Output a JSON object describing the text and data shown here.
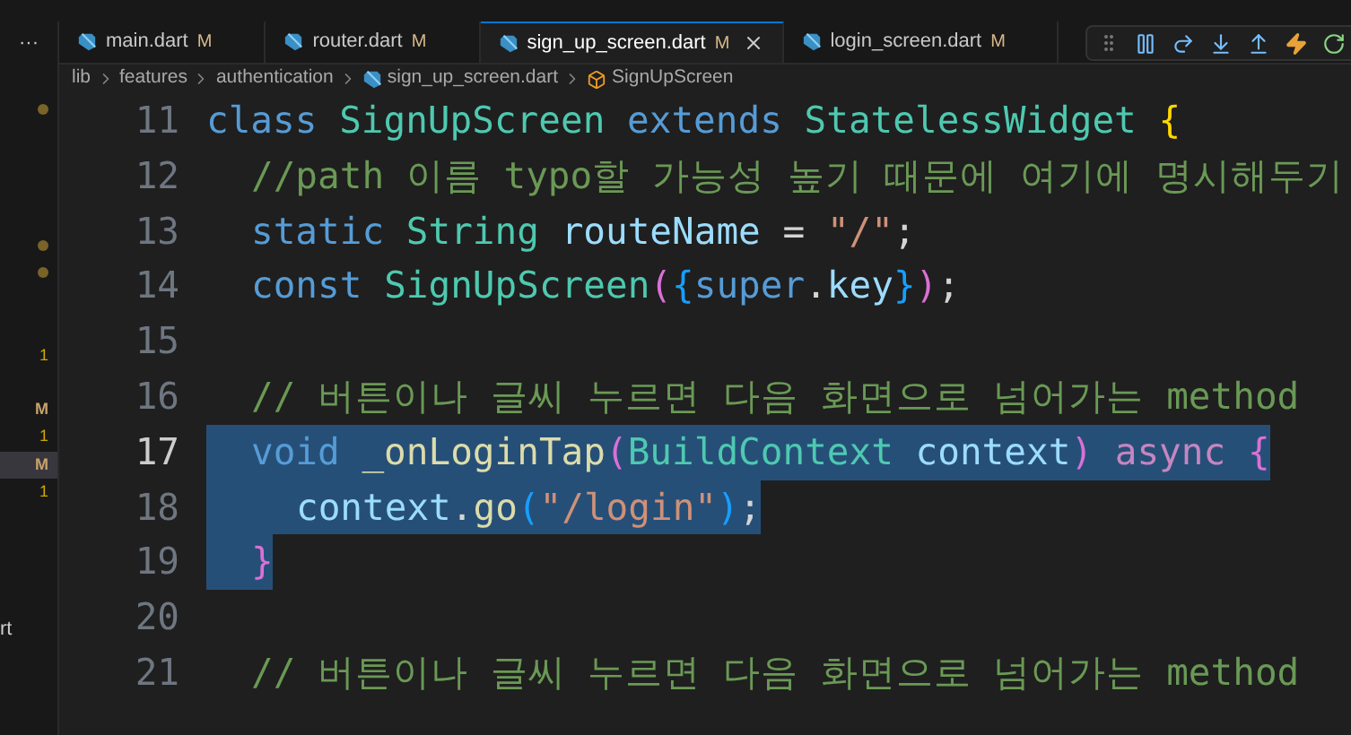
{
  "tabs": [
    {
      "label": "main.dart",
      "badge": "M",
      "selected": false
    },
    {
      "label": "router.dart",
      "badge": "M",
      "selected": false
    },
    {
      "label": "sign_up_screen.dart",
      "badge": "M",
      "selected": true
    },
    {
      "label": "login_screen.dart",
      "badge": "M",
      "selected": false
    }
  ],
  "overflow_menu": "···",
  "breadcrumb": [
    {
      "label": "lib",
      "kind": "folder"
    },
    {
      "label": "features",
      "kind": "folder"
    },
    {
      "label": "authentication",
      "kind": "folder"
    },
    {
      "label": "sign_up_screen.dart",
      "kind": "file"
    },
    {
      "label": "SignUpScreen",
      "kind": "class"
    }
  ],
  "explorer_rows": [
    {
      "kind": "dot"
    },
    {
      "kind": "empty"
    },
    {
      "kind": "empty"
    },
    {
      "kind": "empty"
    },
    {
      "kind": "empty"
    },
    {
      "kind": "dot"
    },
    {
      "kind": "dot"
    },
    {
      "kind": "empty"
    },
    {
      "kind": "empty"
    },
    {
      "kind": "count",
      "badge": "1",
      "selected": false
    },
    {
      "kind": "empty"
    },
    {
      "kind": "letter",
      "badge": "M",
      "selected": false
    },
    {
      "kind": "count",
      "badge": "1",
      "selected": false
    },
    {
      "kind": "letter",
      "badge": "M",
      "selected": true
    },
    {
      "kind": "count",
      "badge": "1",
      "selected": false
    },
    {
      "kind": "empty"
    },
    {
      "kind": "empty"
    },
    {
      "kind": "empty"
    },
    {
      "kind": "empty"
    },
    {
      "kind": "name",
      "name": "rt"
    }
  ],
  "code_lines": [
    {
      "number": "11",
      "kind": "top",
      "active": false,
      "selected": false,
      "tokens": [
        {
          "kind": "kw",
          "text": "class "
        },
        {
          "kind": "type",
          "text": "SignUpScreen "
        },
        {
          "kind": "kw",
          "text": "extends "
        },
        {
          "kind": "type",
          "text": "StatelessWidget "
        },
        {
          "kind": "brace",
          "text": "{"
        }
      ]
    },
    {
      "number": "12",
      "kind": "member",
      "active": false,
      "selected": false,
      "tokens": [
        {
          "kind": "comment",
          "text": "//path 이름 typo할 가능성 높기 때문에 여기에 명시해두기"
        }
      ]
    },
    {
      "number": "13",
      "kind": "member",
      "active": false,
      "selected": false,
      "tokens": [
        {
          "kind": "kw",
          "text": "static "
        },
        {
          "kind": "type",
          "text": "String "
        },
        {
          "kind": "var",
          "text": "routeName"
        },
        {
          "kind": "p",
          "text": " = "
        },
        {
          "kind": "str",
          "text": "\"/\""
        },
        {
          "kind": "p",
          "text": ";"
        }
      ]
    },
    {
      "number": "14",
      "kind": "member",
      "active": false,
      "selected": false,
      "tokens": [
        {
          "kind": "kw",
          "text": "const "
        },
        {
          "kind": "type",
          "text": "SignUpScreen"
        },
        {
          "kind": "bracket",
          "text": "("
        },
        {
          "kind": "bracket2",
          "text": "{"
        },
        {
          "kind": "kw",
          "text": "super"
        },
        {
          "kind": "p",
          "text": "."
        },
        {
          "kind": "var",
          "text": "key"
        },
        {
          "kind": "bracket2",
          "text": "}"
        },
        {
          "kind": "bracket",
          "text": ")"
        },
        {
          "kind": "p",
          "text": ";"
        }
      ]
    },
    {
      "number": "15",
      "kind": "blank",
      "active": false
    },
    {
      "number": "16",
      "kind": "member",
      "active": false,
      "selected": false,
      "tokens": [
        {
          "kind": "comment",
          "text": "// 버튼이나 글씨 누르면 다음 화면으로 넘어가는 method"
        }
      ]
    },
    {
      "number": "17",
      "kind": "member",
      "active": true,
      "selected": true,
      "tokens": [
        {
          "kind": "kw",
          "text": "void "
        },
        {
          "kind": "func",
          "text": "_onLoginTap"
        },
        {
          "kind": "bracket",
          "text": "("
        },
        {
          "kind": "type",
          "text": "BuildContext "
        },
        {
          "kind": "var",
          "text": "context"
        },
        {
          "kind": "bracket",
          "text": ") "
        },
        {
          "kind": "ctrl",
          "text": "async "
        },
        {
          "kind": "bracket",
          "text": "{"
        }
      ]
    },
    {
      "number": "18",
      "kind": "body",
      "active": false,
      "selected": true,
      "tokens": [
        {
          "kind": "var",
          "text": "context"
        },
        {
          "kind": "p",
          "text": "."
        },
        {
          "kind": "func",
          "text": "go"
        },
        {
          "kind": "bracket2",
          "text": "("
        },
        {
          "kind": "str",
          "text": "\"/login\""
        },
        {
          "kind": "bracket2",
          "text": ")"
        },
        {
          "kind": "p",
          "text": ";"
        }
      ]
    },
    {
      "number": "19",
      "kind": "member",
      "active": false,
      "selected": true,
      "tokens": [
        {
          "kind": "bracket",
          "text": "}"
        }
      ]
    },
    {
      "number": "20",
      "kind": "blank",
      "active": false
    },
    {
      "number": "21",
      "kind": "member",
      "active": false,
      "selected": false,
      "tokens": [
        {
          "kind": "comment",
          "text": "// 버튼이나 글씨 누르면 다음 화면으로 넘어가는 method"
        }
      ]
    }
  ]
}
